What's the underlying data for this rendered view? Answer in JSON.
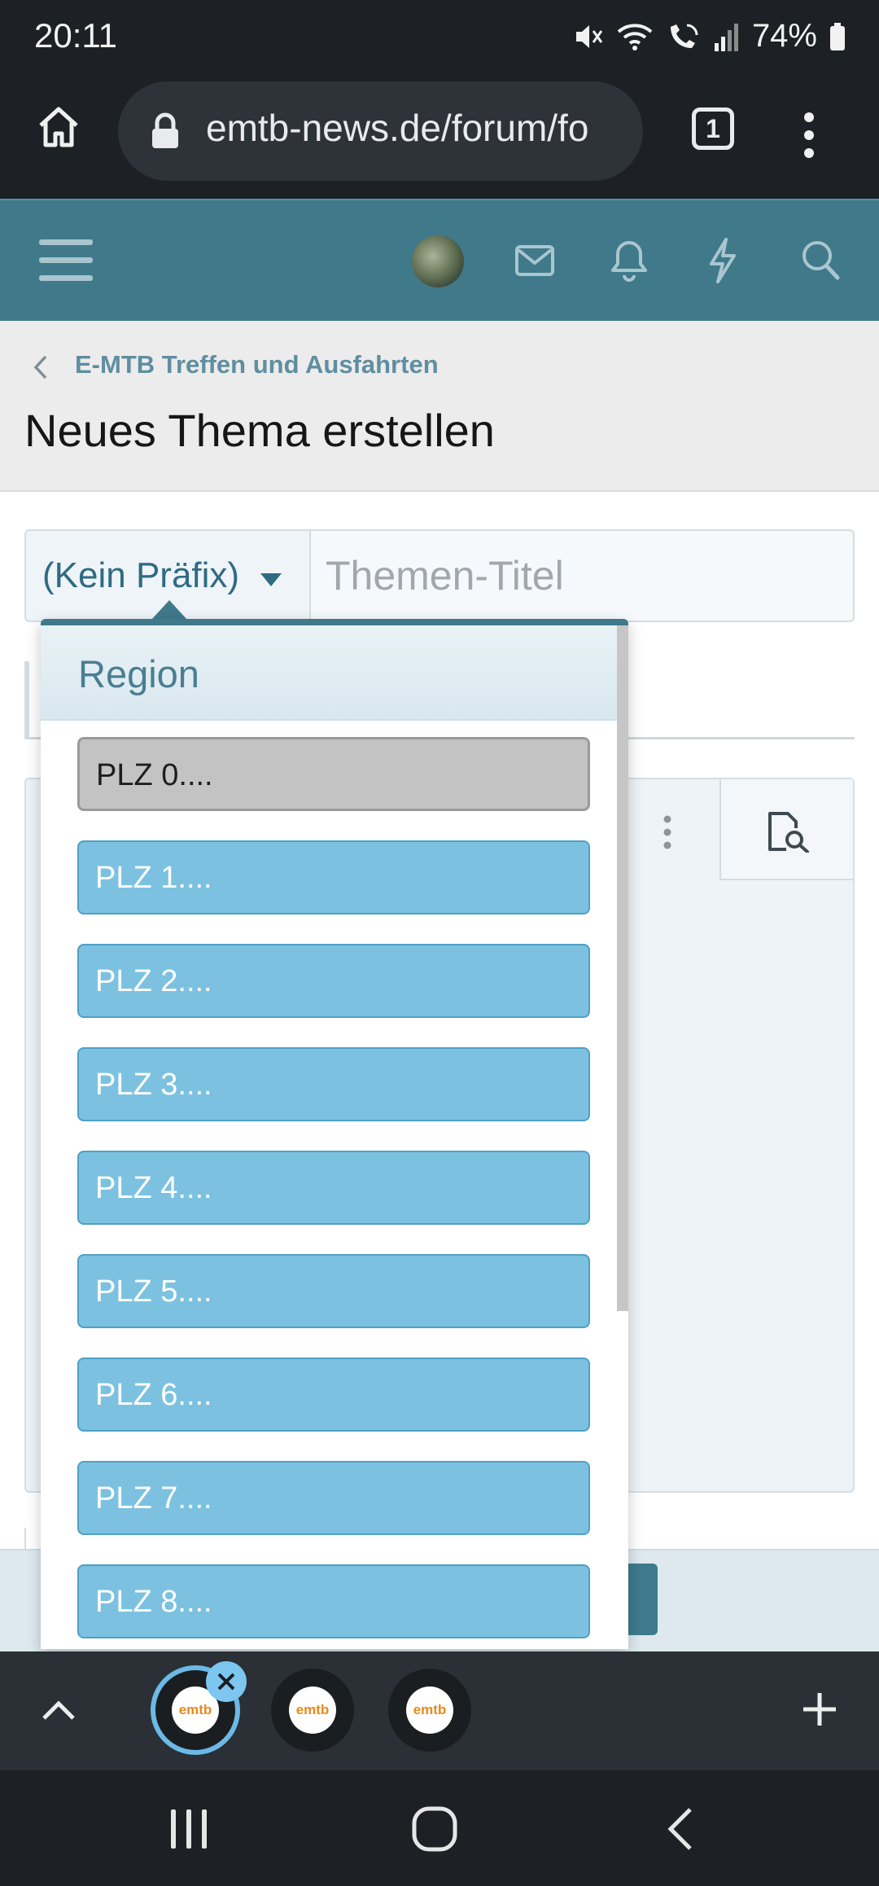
{
  "status_bar": {
    "time": "20:11",
    "battery": "74%",
    "icons": [
      "mute-icon",
      "wifi-icon",
      "wifi-calling-icon",
      "signal-icon",
      "battery-icon"
    ]
  },
  "browser": {
    "url": "emtb-news.de/forum/fo",
    "tab_count": "1",
    "icons": [
      "home-icon",
      "lock-icon",
      "tabs-icon",
      "more-vert-icon"
    ]
  },
  "site_header": {
    "icons": [
      "menu-icon",
      "avatar",
      "mail-icon",
      "bell-icon",
      "lightning-icon",
      "search-icon"
    ],
    "accent": "#40798a"
  },
  "breadcrumb": {
    "label": "E-MTB Treffen und Ausfahrten"
  },
  "page": {
    "title": "Neues Thema erstellen"
  },
  "form": {
    "prefix_selected": "(Kein Präfix)",
    "title_placeholder": "Themen-Titel"
  },
  "prefix_dropdown": {
    "group_label": "Region",
    "options": [
      {
        "label": "PLZ 0....",
        "selected": true
      },
      {
        "label": "PLZ 1....",
        "selected": false
      },
      {
        "label": "PLZ 2....",
        "selected": false
      },
      {
        "label": "PLZ 3....",
        "selected": false
      },
      {
        "label": "PLZ 4....",
        "selected": false
      },
      {
        "label": "PLZ 5....",
        "selected": false
      },
      {
        "label": "PLZ 6....",
        "selected": false
      },
      {
        "label": "PLZ 7....",
        "selected": false
      },
      {
        "label": "PLZ 8....",
        "selected": false
      }
    ],
    "option_color": "#7cc2e0",
    "selected_color": "#c3c3c3"
  },
  "tab_strip": {
    "tabs": [
      {
        "favicon": "emtb",
        "active": true
      },
      {
        "favicon": "emtb",
        "active": false
      },
      {
        "favicon": "emtb",
        "active": false
      }
    ],
    "icons": [
      "chevron-up-icon",
      "close-icon",
      "plus-icon"
    ]
  },
  "nav_bar": {
    "icons": [
      "recents-icon",
      "home-circle-icon",
      "back-icon"
    ]
  }
}
